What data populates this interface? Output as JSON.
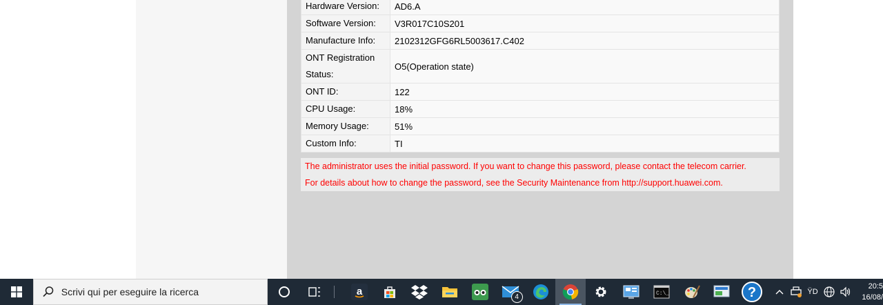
{
  "device_info": {
    "rows": [
      {
        "label": "Hardware Version:",
        "value": "AD6.A"
      },
      {
        "label": "Software Version:",
        "value": "V3R017C10S201"
      },
      {
        "label": "Manufacture Info:",
        "value": "2102312GFG6RL5003617.C402"
      },
      {
        "label": "ONT Registration Status:",
        "value": "O5(Operation state)"
      },
      {
        "label": "ONT ID:",
        "value": "122"
      },
      {
        "label": "CPU Usage:",
        "value": "18%"
      },
      {
        "label": "Memory Usage:",
        "value": "51%"
      },
      {
        "label": "Custom Info:",
        "value": "TI"
      }
    ]
  },
  "warning": {
    "line1": "The administrator uses the initial password. If you want to change this password, please contact the telecom carrier.",
    "line2": "For details about how to change the password, see the Security Maintenance from http://support.huawei.com."
  },
  "taskbar": {
    "search_placeholder": "Scrivi qui per eseguire la ricerca",
    "mail_badge": "4",
    "clock_time": "20:5",
    "clock_date": "16/08/",
    "ime_label": "ŸD"
  },
  "icons": [
    "windows-start-icon",
    "search-icon",
    "cortana-icon",
    "task-view-icon",
    "amazon-icon",
    "store-icon",
    "dropbox-icon",
    "file-explorer-icon",
    "tripadvisor-icon",
    "mail-icon",
    "edge-icon",
    "chrome-icon",
    "settings-icon",
    "control-panel-icon",
    "terminal-icon",
    "paint-icon",
    "network-app-icon",
    "help-icon",
    "chevron-up-icon",
    "printer-icon",
    "ime-icon",
    "globe-icon",
    "volume-icon"
  ]
}
